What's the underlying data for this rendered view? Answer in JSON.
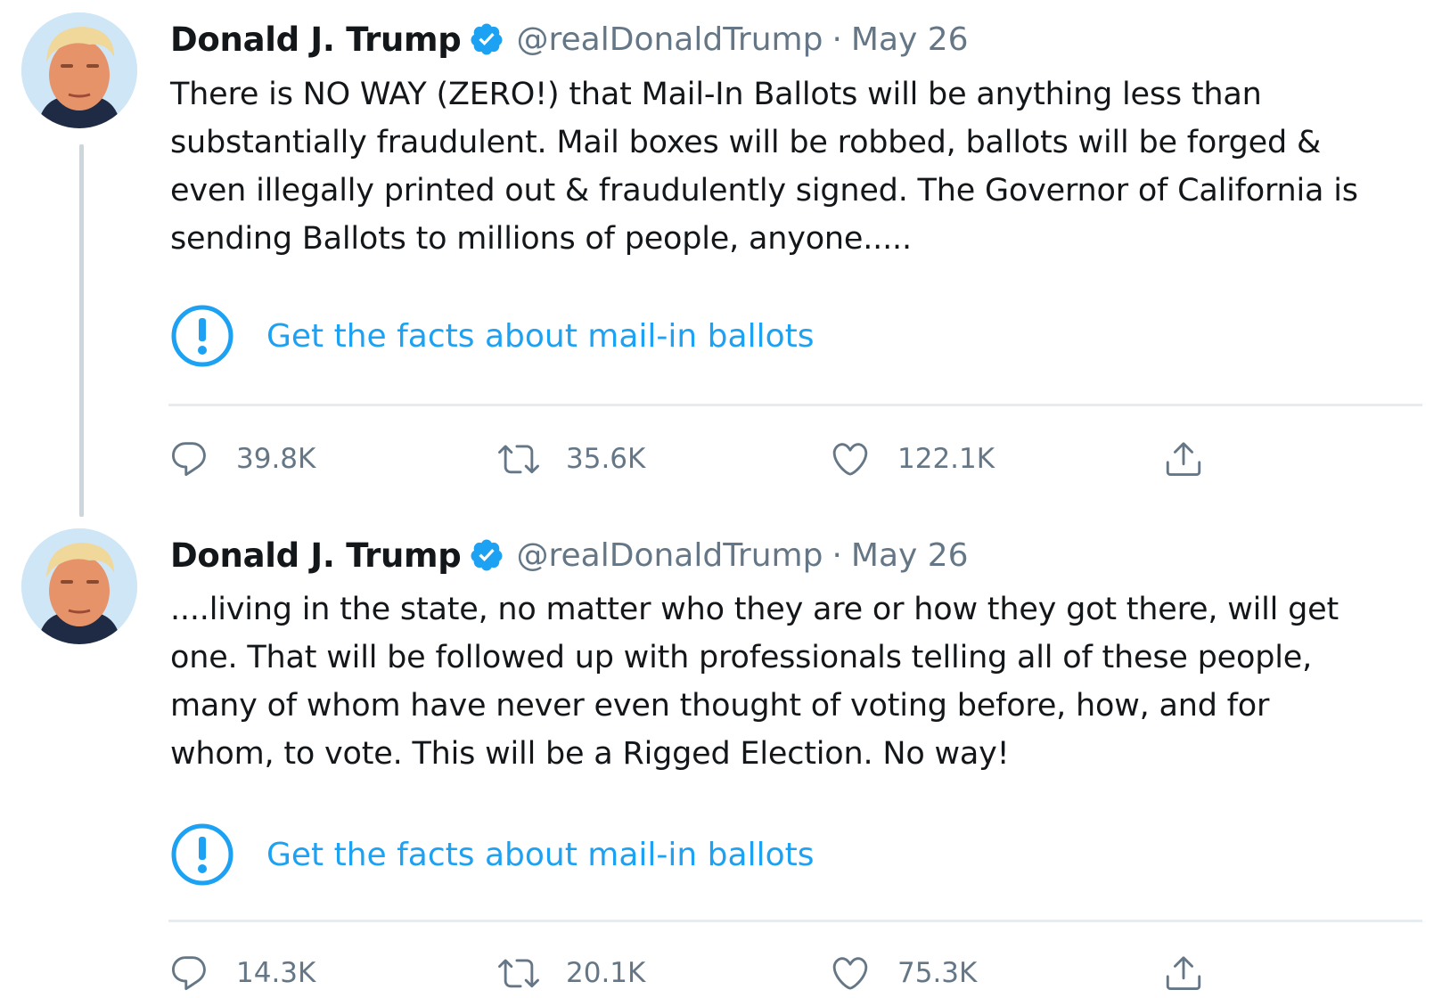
{
  "tweets": [
    {
      "author": {
        "name": "Donald J. Trump",
        "handle": "@realDonaldTrump"
      },
      "separator": "·",
      "date": "May 26",
      "text": "There is NO WAY (ZERO!) that Mail-In Ballots will be anything less than\nsubstantially fraudulent. Mail boxes will be robbed, ballots will be forged &\neven illegally printed out & fraudulently signed. The Governor of California is\nsending Ballots to millions of people, anyone.....",
      "notice": {
        "icon": "exclamation-circle-icon",
        "label": "Get the facts about mail-in ballots"
      },
      "metrics": {
        "replies": "39.8K",
        "retweets": "35.6K",
        "likes": "122.1K"
      }
    },
    {
      "author": {
        "name": "Donald J. Trump",
        "handle": "@realDonaldTrump"
      },
      "separator": "·",
      "date": "May 26",
      "text": "....living in the state, no matter who they are or how they got there, will get\none. That will be followed up with professionals telling all of these people,\nmany of whom have never even thought of voting before, how, and for\nwhom, to vote. This will be a Rigged Election. No way!",
      "notice": {
        "icon": "exclamation-circle-icon",
        "label": "Get the facts about mail-in ballots"
      },
      "metrics": {
        "replies": "14.3K",
        "retweets": "20.1K",
        "likes": "75.3K"
      }
    }
  ],
  "icons": [
    "verified-badge-icon",
    "reply-icon",
    "retweet-icon",
    "like-icon",
    "share-icon"
  ],
  "colors": {
    "accent": "#1da1f2",
    "text": "#14171a",
    "secondary": "#657786",
    "divider": "#e6ecf0",
    "thread_line": "#ccd6dd"
  }
}
